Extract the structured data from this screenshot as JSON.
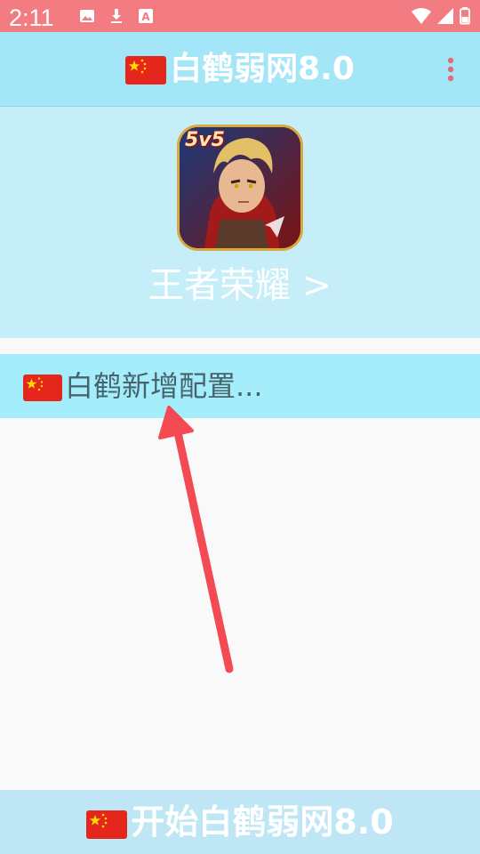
{
  "status_bar": {
    "time": "2:11",
    "icons": [
      "image-icon",
      "download-icon",
      "a-text-icon",
      "wifi-icon",
      "signal-icon",
      "battery-icon"
    ],
    "color": "#f27c81"
  },
  "app_bar": {
    "title": "白鹤弱网8.0",
    "flag_icon": "china-flag-icon",
    "menu_icon": "more-vert-icon",
    "color": "#a3e6f7"
  },
  "hero": {
    "game_name": "王者荣耀 >",
    "game_icon": "honor-of-kings-icon",
    "badge_text": "5v5",
    "color": "#c5eef9"
  },
  "config": {
    "label": "白鹤新增配置...",
    "flag_icon": "china-flag-icon",
    "color": "#a3eefa"
  },
  "bottom": {
    "button_label": "开始白鹤弱网8.0",
    "flag_icon": "china-flag-icon",
    "color": "#bfe6f4"
  },
  "annotation": {
    "arrow_icon": "red-arrow-icon",
    "arrow_color": "#f44a54"
  }
}
